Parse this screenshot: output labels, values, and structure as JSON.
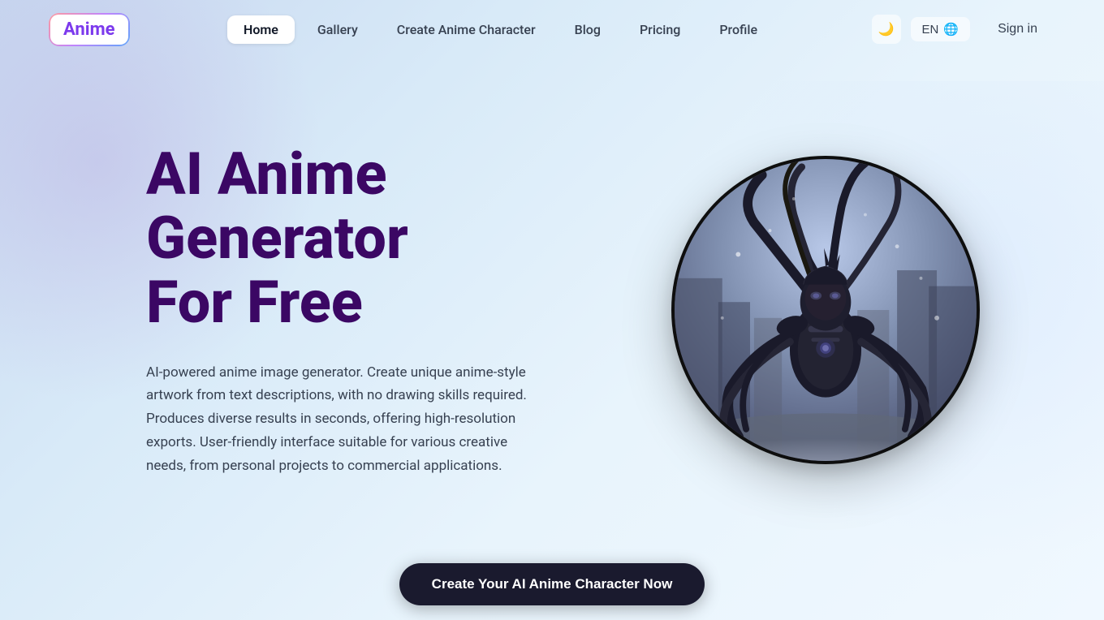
{
  "logo": {
    "prefix": "",
    "highlight": "Anime",
    "full": "Anime"
  },
  "nav": {
    "links": [
      {
        "id": "home",
        "label": "Home",
        "active": true
      },
      {
        "id": "gallery",
        "label": "Gallery",
        "active": false
      },
      {
        "id": "create",
        "label": "Create Anime Character",
        "active": false
      },
      {
        "id": "blog",
        "label": "Blog",
        "active": false
      },
      {
        "id": "pricing",
        "label": "Pricing",
        "active": false
      },
      {
        "id": "profile",
        "label": "Profile",
        "active": false
      }
    ],
    "lang": "EN",
    "sign_in_label": "Sign in"
  },
  "hero": {
    "title_line1": "AI Anime",
    "title_line2": "Generator",
    "title_line3": "For Free",
    "description": "AI-powered anime image generator. Create unique anime-style artwork from text descriptions, with no drawing skills required. Produces diverse results in seconds, offering high-resolution exports. User-friendly interface suitable for various creative needs, from personal projects to commercial applications.",
    "image_alt": "Anime character artwork"
  },
  "cta": {
    "label": "Create Your AI Anime Character Now"
  },
  "icons": {
    "moon": "🌙",
    "globe": "🌐"
  }
}
